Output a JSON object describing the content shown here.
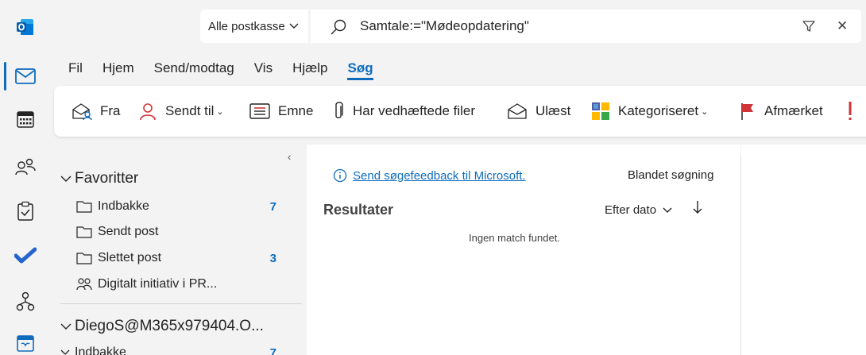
{
  "app": {
    "logo_icon": "outlook-logo-icon",
    "accent_color": "#0f6cbd"
  },
  "search": {
    "scope_label": "Alle postkasse",
    "query": "Samtale:=\"Mødeopdatering\""
  },
  "rail": [
    {
      "icon": "mail-icon",
      "active": true
    },
    {
      "icon": "calendar-icon"
    },
    {
      "icon": "people-icon"
    },
    {
      "icon": "tasks-icon"
    },
    {
      "icon": "todo-icon"
    },
    {
      "icon": "org-icon"
    },
    {
      "icon": "bookings-icon"
    }
  ],
  "menu": [
    "Fil",
    "Hjem",
    "Send/modtag",
    "Vis",
    "Hjælp",
    "Søg"
  ],
  "menu_active": "Søg",
  "ribbon": {
    "from": "Fra",
    "sent_to": "Sendt til",
    "subject": "Emne",
    "attachments": "Har vedhæftede filer",
    "unread": "Ulæst",
    "categorized": "Kategoriseret",
    "flagged": "Afmærket"
  },
  "folders": {
    "favorites_label": "Favoritter",
    "favorites": [
      {
        "name": "Indbakke",
        "count": "7"
      },
      {
        "name": "Sendt post",
        "count": ""
      },
      {
        "name": "Slettet post",
        "count": "3"
      },
      {
        "name": "Digitalt initiativ i PR...",
        "count": ""
      }
    ],
    "account_label": "DiegoS@M365x979404.O...",
    "account_first": {
      "name": "Indbakke",
      "count": "7"
    }
  },
  "results": {
    "feedback_link": "Send søgefeedback til Microsoft.",
    "mixed_search": "Blandet søgning",
    "title": "Resultater",
    "sort_label": "Efter dato",
    "no_match": "Ingen match fundet."
  }
}
